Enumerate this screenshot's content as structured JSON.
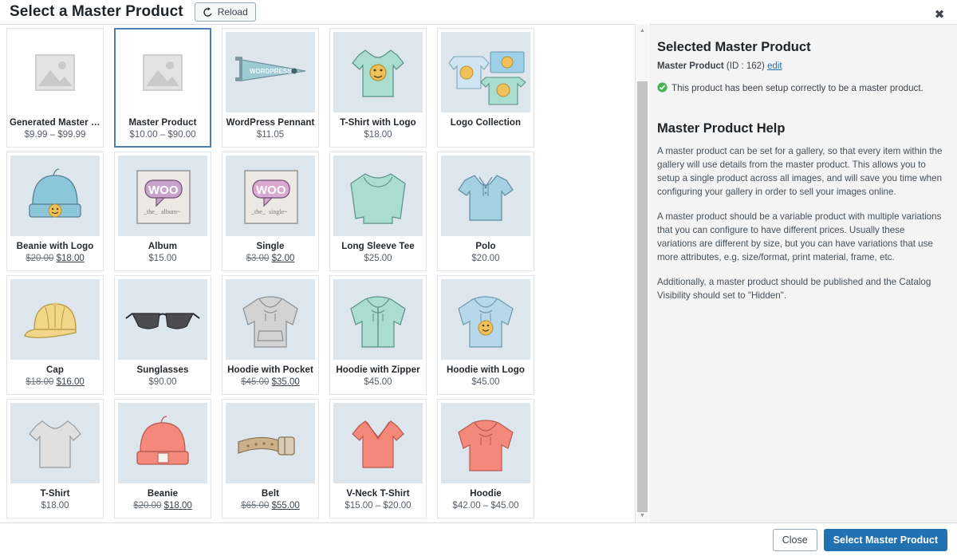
{
  "header": {
    "title": "Select a Master Product",
    "reload_label": "Reload",
    "reload_icon": "refresh-icon",
    "close_icon": "close-icon"
  },
  "products": [
    {
      "name": "Generated Master Product",
      "price": "$9.99 – $99.99",
      "art": "placeholder",
      "selected": false
    },
    {
      "name": "Master Product",
      "price": "$10.00 – $90.00",
      "art": "placeholder",
      "selected": true
    },
    {
      "name": "WordPress Pennant",
      "price": "$11.05",
      "art": "pennant",
      "selected": false
    },
    {
      "name": "T-Shirt with Logo",
      "price": "$18.00",
      "art": "tshirt-logo",
      "selected": false
    },
    {
      "name": "Logo Collection",
      "price": "",
      "art": "logo-collection",
      "selected": false
    },
    {
      "name": "Beanie with Logo",
      "price_old": "$20.00",
      "price_new": "$18.00",
      "art": "beanie-logo",
      "selected": false
    },
    {
      "name": "Album",
      "price": "$15.00",
      "art": "album",
      "selected": false
    },
    {
      "name": "Single",
      "price_old": "$3.00",
      "price_new": "$2.00",
      "art": "single",
      "selected": false
    },
    {
      "name": "Long Sleeve Tee",
      "price": "$25.00",
      "art": "longsleeve",
      "selected": false
    },
    {
      "name": "Polo",
      "price": "$20.00",
      "art": "polo",
      "selected": false
    },
    {
      "name": "Cap",
      "price_old": "$18.00",
      "price_new": "$16.00",
      "art": "cap",
      "selected": false
    },
    {
      "name": "Sunglasses",
      "price": "$90.00",
      "art": "sunglasses",
      "selected": false
    },
    {
      "name": "Hoodie with Pocket",
      "price_old": "$45.00",
      "price_new": "$35.00",
      "art": "hoodie-pocket",
      "selected": false
    },
    {
      "name": "Hoodie with Zipper",
      "price": "$45.00",
      "art": "hoodie-zipper",
      "selected": false
    },
    {
      "name": "Hoodie with Logo",
      "price": "$45.00",
      "art": "hoodie-logo",
      "selected": false
    },
    {
      "name": "T-Shirt",
      "price": "$18.00",
      "art": "tshirt-grey",
      "selected": false
    },
    {
      "name": "Beanie",
      "price_old": "$20.00",
      "price_new": "$18.00",
      "art": "beanie",
      "selected": false
    },
    {
      "name": "Belt",
      "price_old": "$65.00",
      "price_new": "$55.00",
      "art": "belt",
      "selected": false
    },
    {
      "name": "V-Neck T-Shirt",
      "price": "$15.00 – $20.00",
      "art": "vneck",
      "selected": false
    },
    {
      "name": "Hoodie",
      "price": "$42.00 – $45.00",
      "art": "hoodie",
      "selected": false
    }
  ],
  "info": {
    "selected_heading": "Selected Master Product",
    "mp_label": "Master Product",
    "mp_id": "(ID : 162)",
    "edit_link": "edit",
    "status_icon": "check-circle-icon",
    "status_text": "This product has been setup correctly to be a master product.",
    "help_heading": "Master Product Help",
    "paragraphs": [
      "A master product can be set for a gallery, so that every item within the gallery will use details from the master product. This allows you to setup a single product across all images, and will save you time when configuring your gallery in order to sell your images online.",
      "A master product should be a variable product with multiple variations that you can configure to have different prices. Usually these variations are different by size, but you can have variations that use more attributes, e.g. size/format, print material, frame, etc.",
      "Additionally, a master product should be published and the Catalog Visibility should set to \"Hidden\"."
    ]
  },
  "scrollbar": {
    "up_icon": "scroll-up-arrow-icon",
    "down_icon": "scroll-down-arrow-icon"
  },
  "footer": {
    "close_label": "Close",
    "select_label": "Select Master Product"
  },
  "colors": {
    "accent": "#2271b1",
    "selected_border": "#4b7fb5",
    "status_green": "#46b450",
    "thumb_bg": "#dde6ed"
  }
}
